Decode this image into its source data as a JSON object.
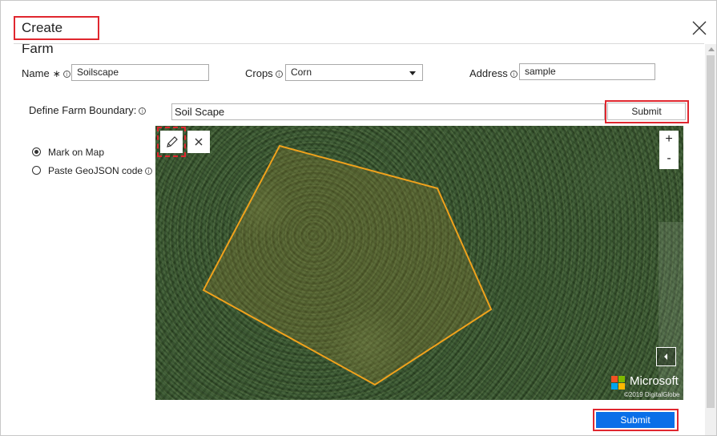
{
  "dialog": {
    "title": "Create Farm",
    "close_icon": "close-icon"
  },
  "form": {
    "name": {
      "label": "Name",
      "required_mark": "∗",
      "value": "Soilscape"
    },
    "crops": {
      "label": "Crops",
      "value": "Corn"
    },
    "address": {
      "label": "Address",
      "value": "sample"
    },
    "info_glyph": "i"
  },
  "boundary": {
    "label": "Define Farm Boundary:",
    "options": [
      {
        "label": "Mark on Map",
        "selected": true
      },
      {
        "label": "Paste GeoJSON code",
        "selected": false
      }
    ],
    "name_value": "Soil Scape",
    "submit_label": "Submit"
  },
  "map": {
    "tools": {
      "draw_icon": "pencil-icon",
      "clear_icon": "close-icon"
    },
    "zoom_in": "+",
    "zoom_out": "-",
    "collapse_icon": "chevron-left-icon",
    "brand": "Microsoft",
    "copyright": "©2019 DigitalGlobe",
    "polygon_color": "#f0a21c"
  },
  "footer": {
    "submit_label": "Submit"
  },
  "colors": {
    "highlight": "#e0272f",
    "primary": "#0a6fe8"
  }
}
